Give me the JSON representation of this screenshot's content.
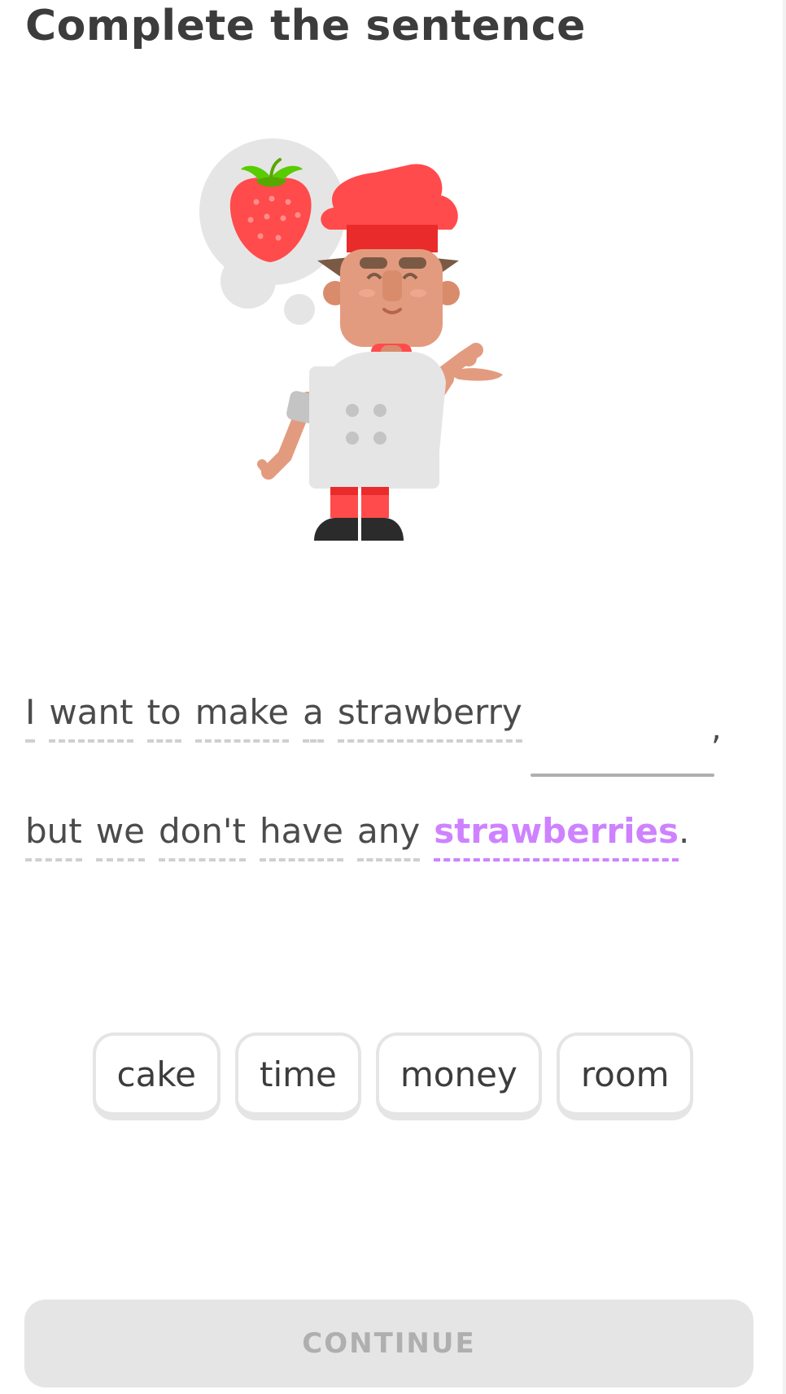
{
  "header": {
    "title": "Complete the sentence"
  },
  "illustration": {
    "character": "chef-character",
    "thought": "strawberry"
  },
  "sentence": {
    "line1": [
      "I",
      "want",
      "to",
      "make",
      "a",
      "strawberry"
    ],
    "comma": ",",
    "line2": [
      "but",
      "we",
      "don't",
      "have",
      "any"
    ],
    "highlight": "strawberries",
    "period": "."
  },
  "choices": [
    "cake",
    "time",
    "money",
    "room"
  ],
  "footer": {
    "continue_label": "CONTINUE"
  },
  "colors": {
    "highlight": "#ce82ff",
    "chef_hat": "#ff4b4b",
    "disabled_button": "#e5e5e5"
  }
}
